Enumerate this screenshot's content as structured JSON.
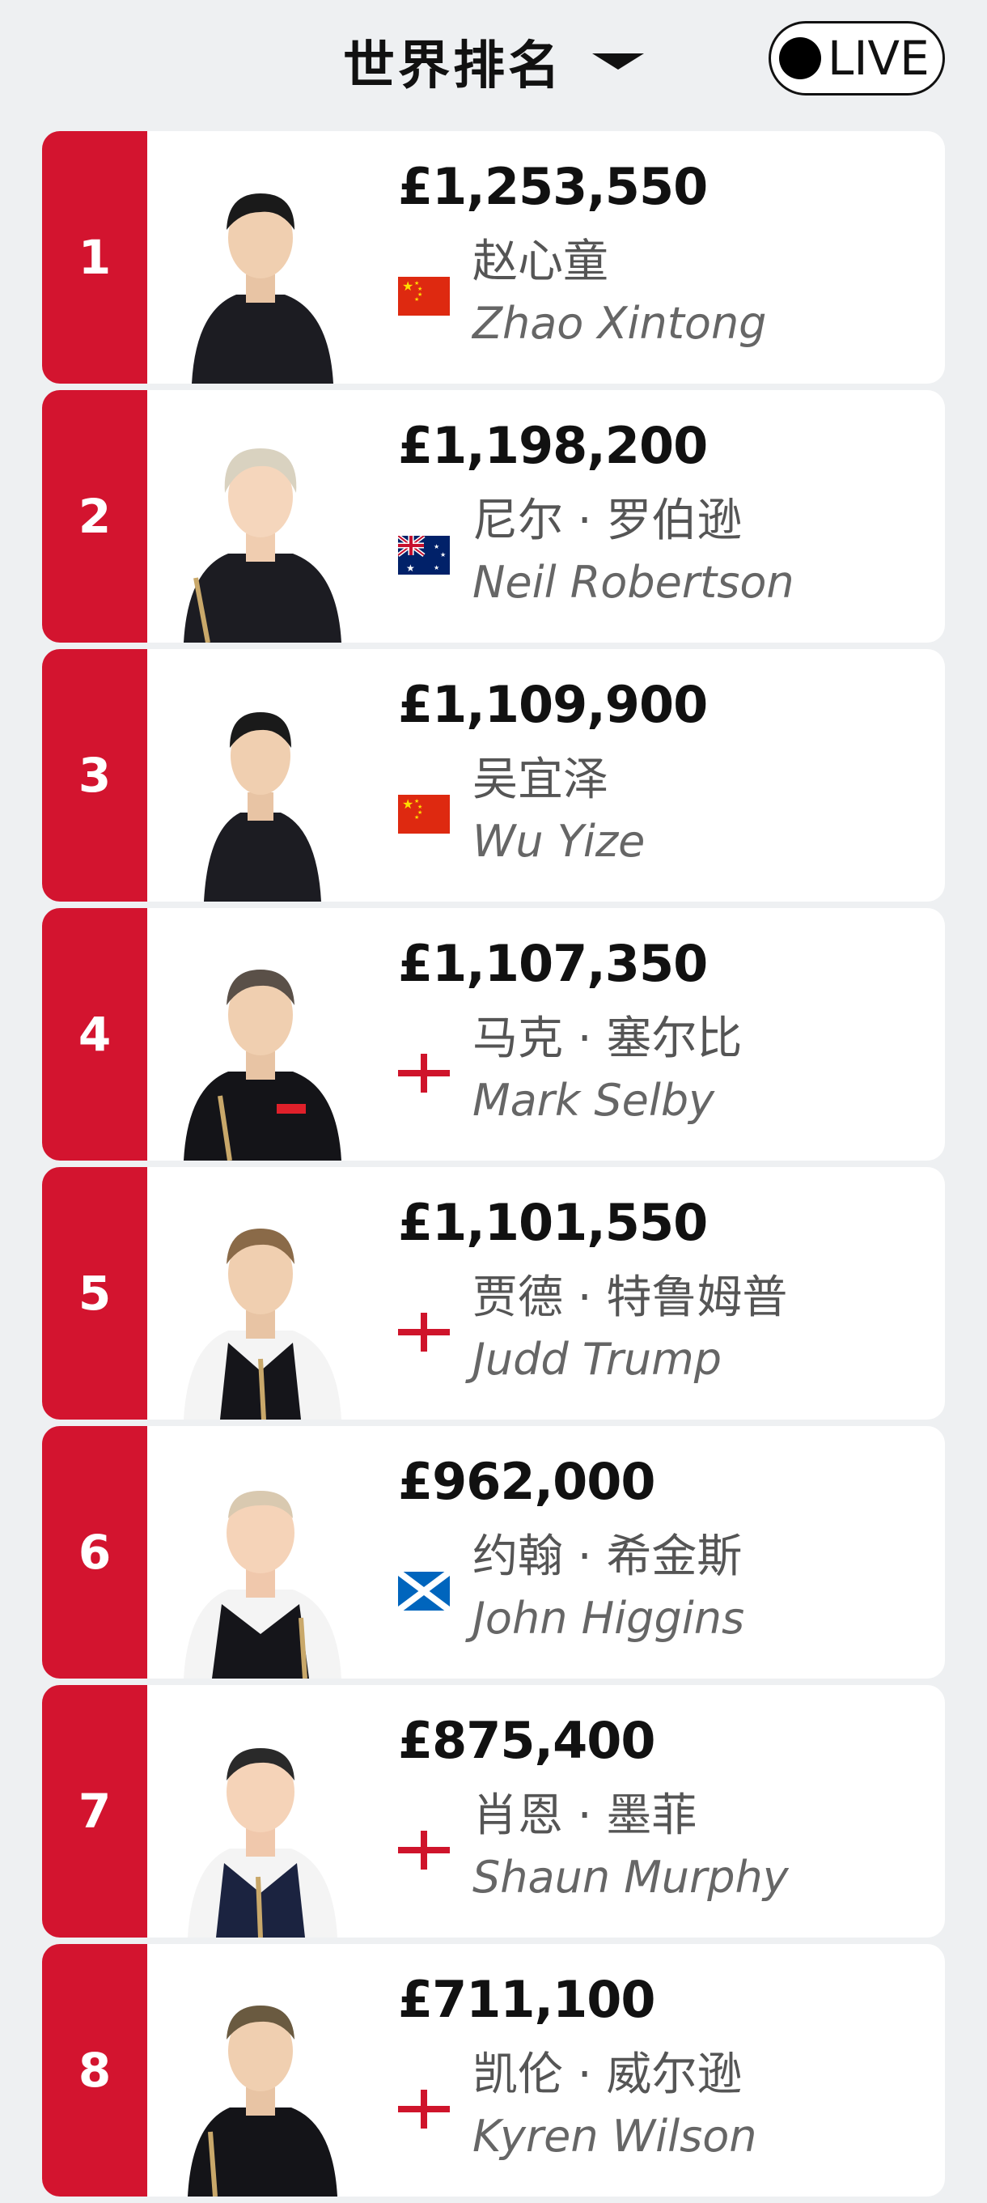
{
  "header": {
    "title": "世界排名",
    "live_label": "LIVE"
  },
  "players": [
    {
      "rank": "1",
      "prize": "£1,253,550",
      "cn": "赵心童",
      "en": "Zhao Xintong",
      "flag": "china"
    },
    {
      "rank": "2",
      "prize": "£1,198,200",
      "cn": "尼尔 · 罗伯逊",
      "en": "Neil Robertson",
      "flag": "australia"
    },
    {
      "rank": "3",
      "prize": "£1,109,900",
      "cn": "吴宜泽",
      "en": "Wu Yize",
      "flag": "china"
    },
    {
      "rank": "4",
      "prize": "£1,107,350",
      "cn": "马克 · 塞尔比",
      "en": "Mark Selby",
      "flag": "england"
    },
    {
      "rank": "5",
      "prize": "£1,101,550",
      "cn": "贾德 · 特鲁姆普",
      "en": "Judd Trump",
      "flag": "england"
    },
    {
      "rank": "6",
      "prize": "£962,000",
      "cn": "约翰 · 希金斯",
      "en": "John Higgins",
      "flag": "scotland"
    },
    {
      "rank": "7",
      "prize": "£875,400",
      "cn": "肖恩 · 墨菲",
      "en": "Shaun Murphy",
      "flag": "england"
    },
    {
      "rank": "8",
      "prize": "£711,100",
      "cn": "凯伦 · 威尔逊",
      "en": "Kyren Wilson",
      "flag": "england"
    }
  ],
  "colors": {
    "rank_red": "#d3142f",
    "background": "#eef0f2"
  }
}
